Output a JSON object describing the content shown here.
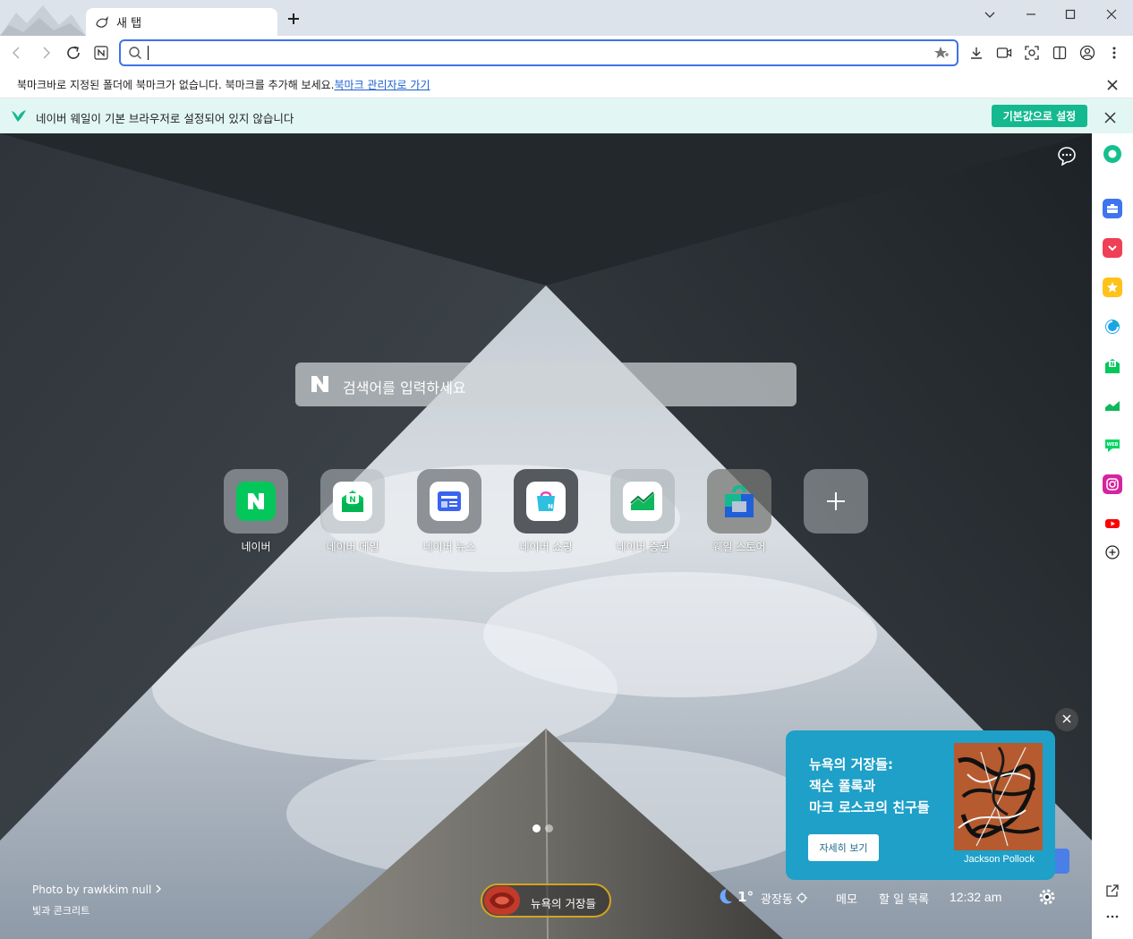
{
  "tab": {
    "title": "새 탭"
  },
  "toolbar": {
    "address_value": ""
  },
  "bookmarks": {
    "message": "북마크바로 지정된 폴더에 북마크가 없습니다. 북마크를 추가해 보세요.",
    "manager_link": "북마크 관리자로 가기"
  },
  "infobar": {
    "message": "네이버 웨일이 기본 브라우저로 설정되어 있지 않습니다",
    "set_default_label": "기본값으로 설정"
  },
  "search": {
    "placeholder": "검색어를 입력하세요"
  },
  "shortcuts": [
    {
      "label": "네이버",
      "icon": "naver-logo-icon",
      "color": "#03c75a"
    },
    {
      "label": "네이버 메일",
      "icon": "naver-mail-icon",
      "color": "#03c75a"
    },
    {
      "label": "네이버 뉴스",
      "icon": "naver-news-icon",
      "color": "#3a63f0"
    },
    {
      "label": "네이버 쇼핑",
      "icon": "naver-shopping-icon",
      "color": "#2fc0e0"
    },
    {
      "label": "네이버 증권",
      "icon": "naver-stock-icon",
      "color": "#0fb85c"
    },
    {
      "label": "웨일 스토어",
      "icon": "whale-store-icon",
      "color": "#1f5fd8"
    }
  ],
  "photo": {
    "credit": "Photo by rawkkim null",
    "title": "빛과 콘크리트"
  },
  "pill": {
    "label": "뉴욕의 거장들"
  },
  "weather": {
    "temp": "1°",
    "location": "광장동"
  },
  "bottom_links": {
    "memo": "메모",
    "todo": "할 일 목록",
    "time": "12:32 am"
  },
  "promo": {
    "line1": "뉴욕의 거장들:",
    "line2": "잭슨 폴록과",
    "line3": "마크 로스코의 친구들",
    "button": "자세히 보기",
    "artist": "Jackson Pollock"
  },
  "colors": {
    "accent": "#14b98f",
    "omnibox_border": "#3f73e6",
    "promo_bg": "#1ea0c8"
  }
}
